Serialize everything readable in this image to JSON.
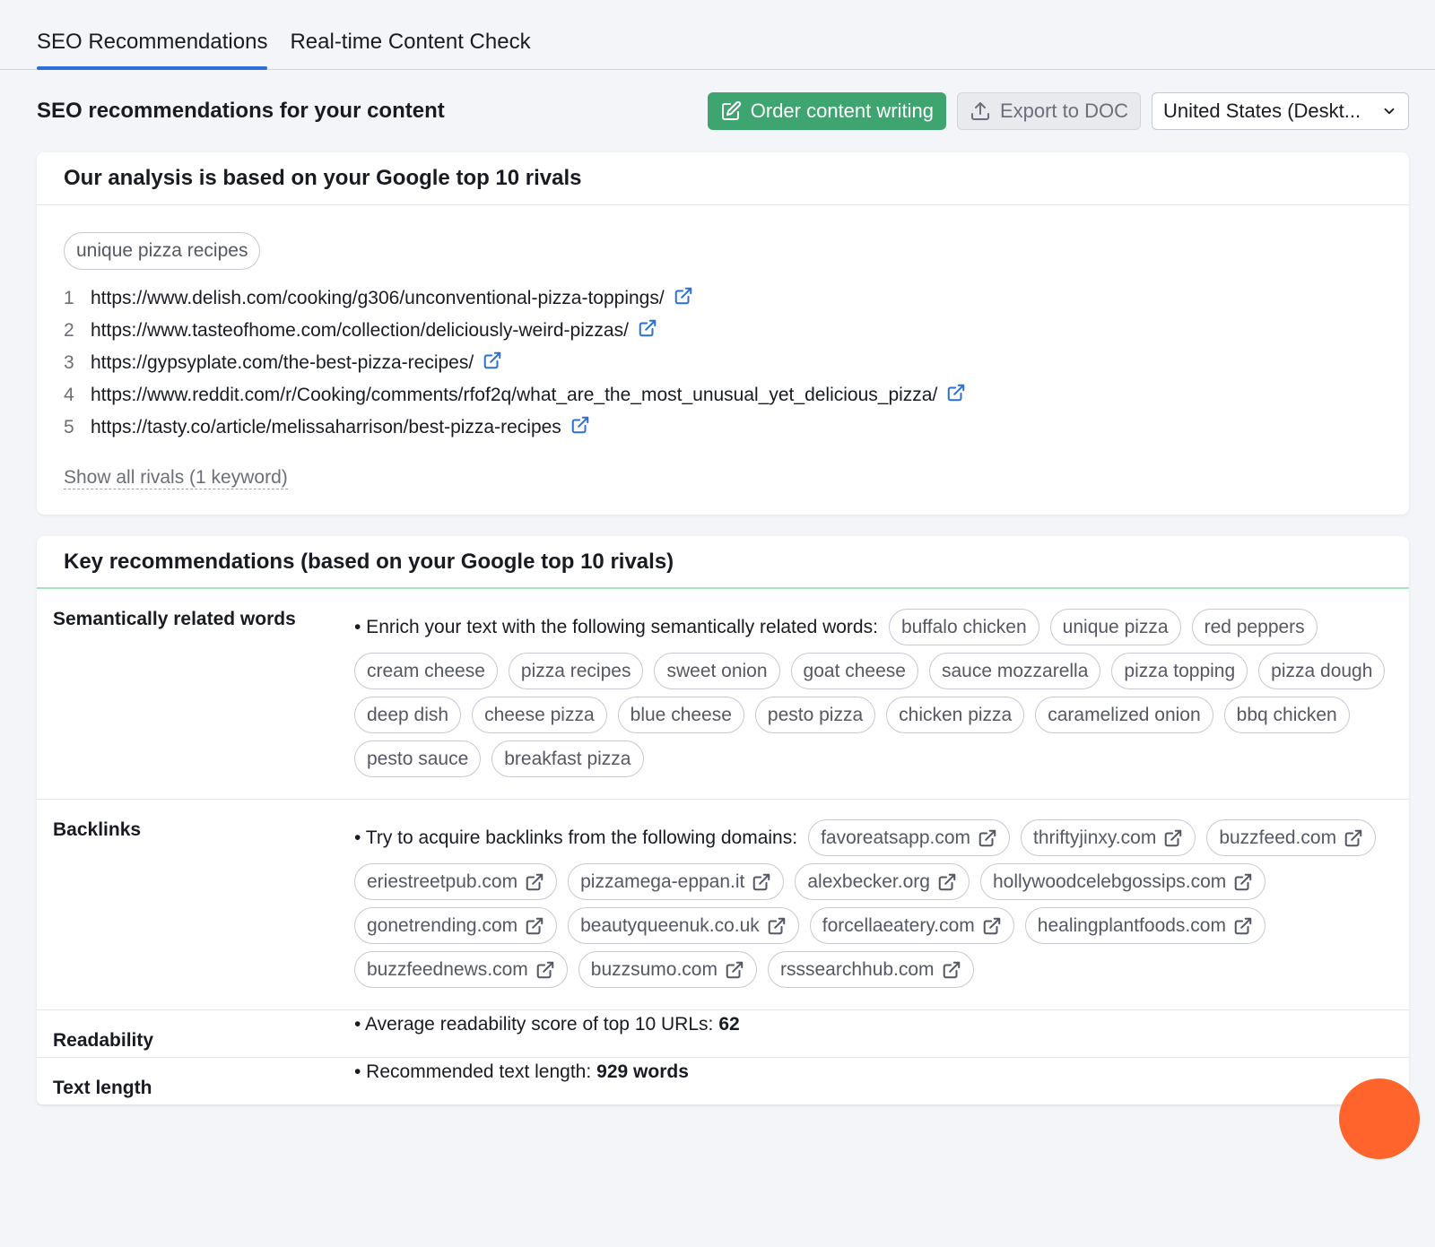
{
  "tabs": [
    {
      "label": "SEO Recommendations",
      "active": true
    },
    {
      "label": "Real-time Content Check",
      "active": false
    }
  ],
  "header": {
    "title": "SEO recommendations for your content",
    "order_button": "Order content writing",
    "export_button": "Export to DOC",
    "region_select": "United States (Deskt..."
  },
  "analysis": {
    "title": "Our analysis is based on your Google top 10 rivals",
    "keyword": "unique pizza recipes",
    "rivals": [
      {
        "num": "1",
        "url": "https://www.delish.com/cooking/g306/unconventional-pizza-toppings/"
      },
      {
        "num": "2",
        "url": "https://www.tasteofhome.com/collection/deliciously-weird-pizzas/"
      },
      {
        "num": "3",
        "url": "https://gypsyplate.com/the-best-pizza-recipes/"
      },
      {
        "num": "4",
        "url": "https://www.reddit.com/r/Cooking/comments/rfof2q/what_are_the_most_unusual_yet_delicious_pizza/"
      },
      {
        "num": "5",
        "url": "https://tasty.co/article/melissaharrison/best-pizza-recipes"
      }
    ],
    "show_all": "Show all rivals (1 keyword)"
  },
  "recommendations": {
    "title": "Key recommendations (based on your Google top 10 rivals)",
    "semantic": {
      "label": "Semantically related words",
      "intro": "• Enrich your text with the following semantically related words:",
      "words": [
        "buffalo chicken",
        "unique pizza",
        "red peppers",
        "cream cheese",
        "pizza recipes",
        "sweet onion",
        "goat cheese",
        "sauce mozzarella",
        "pizza topping",
        "pizza dough",
        "deep dish",
        "cheese pizza",
        "blue cheese",
        "pesto pizza",
        "chicken pizza",
        "caramelized onion",
        "bbq chicken",
        "pesto sauce",
        "breakfast pizza"
      ]
    },
    "backlinks": {
      "label": "Backlinks",
      "intro": "• Try to acquire backlinks from the following domains:",
      "domains": [
        "favoreatsapp.com",
        "thriftyjinxy.com",
        "buzzfeed.com",
        "eriestreetpub.com",
        "pizzamega-eppan.it",
        "alexbecker.org",
        "hollywoodcelebgossips.com",
        "gonetrending.com",
        "beautyqueenuk.co.uk",
        "forcellaeatery.com",
        "healingplantfoods.com",
        "buzzfeednews.com",
        "buzzsumo.com",
        "rsssearchhub.com"
      ]
    },
    "readability": {
      "label": "Readability",
      "text": "• Average readability score of top 10 URLs:",
      "value": "62"
    },
    "text_length": {
      "label": "Text length",
      "text": "• Recommended text length:",
      "value": "929 words"
    }
  },
  "colors": {
    "accent_blue": "#2d6fd5",
    "green": "#3ea570",
    "orange_fab": "#ff642d"
  }
}
